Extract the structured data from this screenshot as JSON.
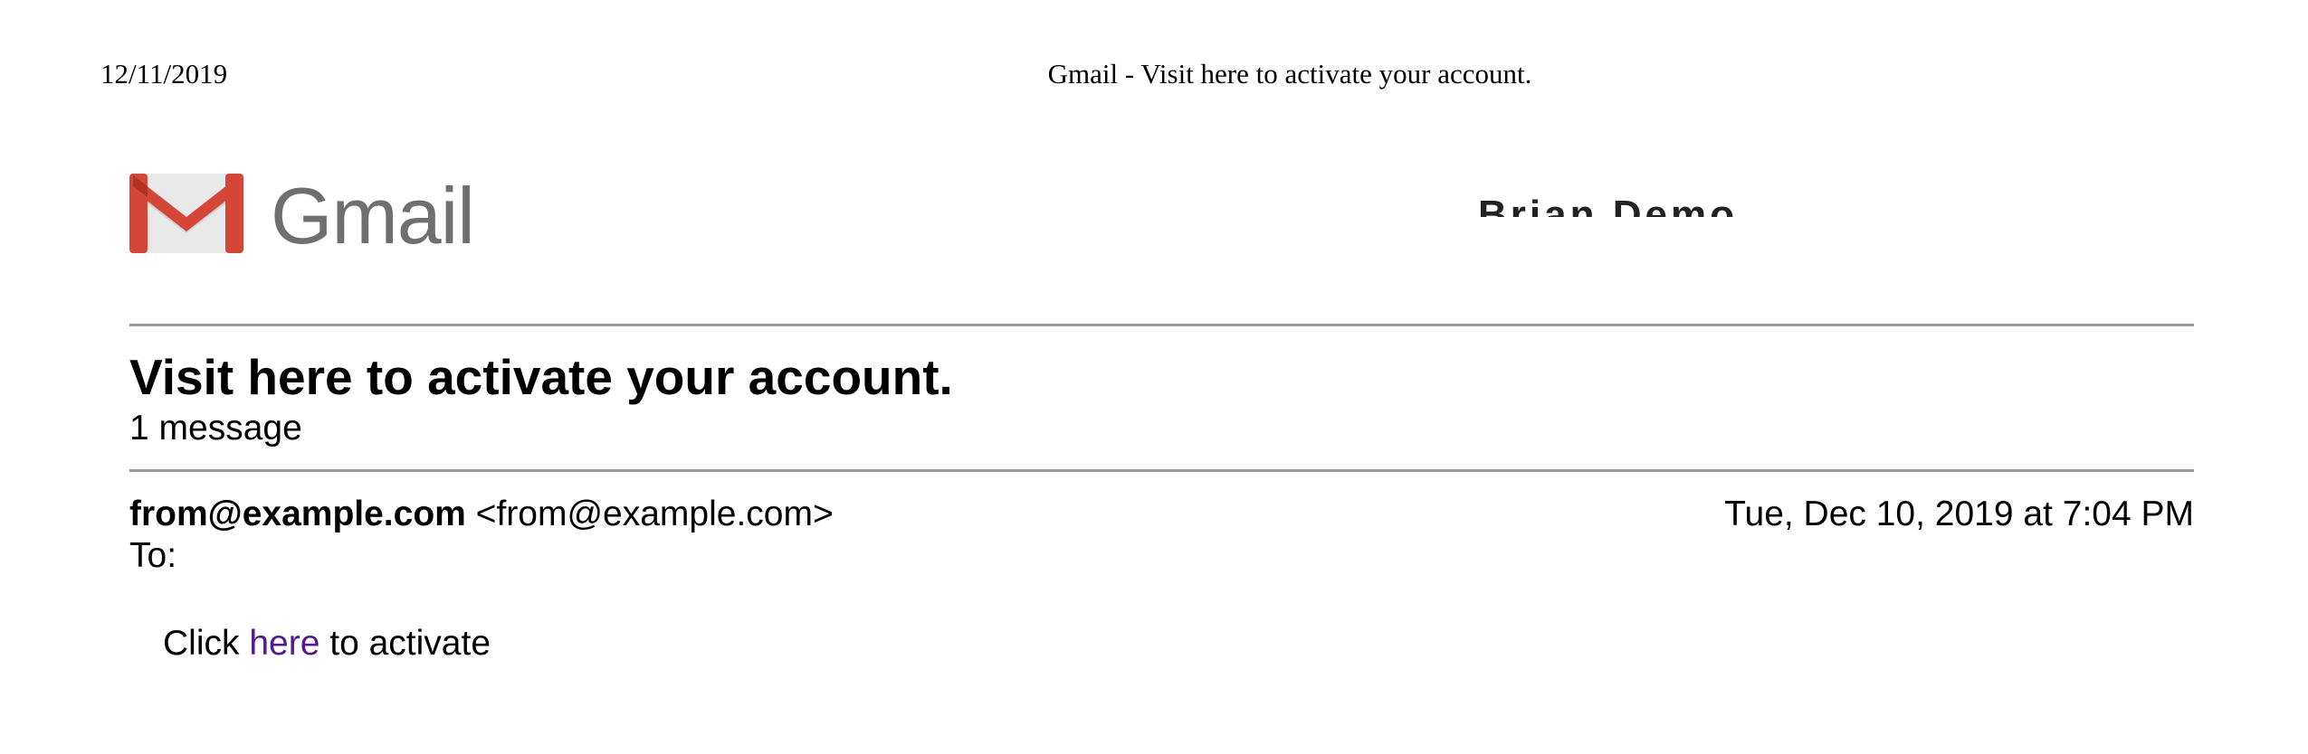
{
  "print_header": {
    "date": "12/11/2019",
    "title": "Gmail - Visit here to activate your account."
  },
  "brand": {
    "wordmark": "Gmail",
    "logo_icon": "gmail-m-logo-icon",
    "colors": {
      "logo_red": "#d44638",
      "logo_dark_red": "#b23121",
      "logo_gray": "#e8e8e8",
      "wordmark_gray": "#6f6f6f"
    }
  },
  "account": {
    "name": "Brian Demo <brian@example.com>"
  },
  "thread": {
    "subject": "Visit here to activate your account.",
    "message_count": "1 message"
  },
  "message": {
    "from_name": "from@example.com",
    "from_email": "<from@example.com>",
    "date": "Tue, Dec 10, 2019 at 7:04 PM",
    "to_label": "To:",
    "body_prefix": "Click ",
    "link_text": "here",
    "body_suffix": " to activate",
    "link_color": "#551a8b"
  }
}
